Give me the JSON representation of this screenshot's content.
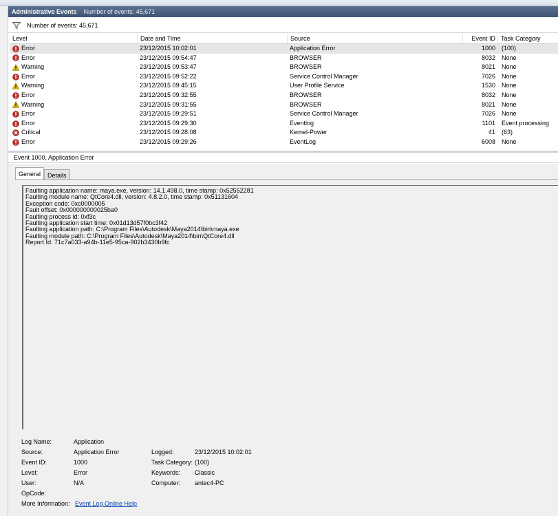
{
  "window": {
    "title": "Administrative Events",
    "count_text": "Number of events: 45,671"
  },
  "filter": {
    "text": "Number of events: 45,671"
  },
  "columns": [
    "Level",
    "Date and Time",
    "Source",
    "Event ID",
    "Task Category"
  ],
  "rows": [
    {
      "level": "Error",
      "type": "error",
      "date": "23/12/2015 10:02:01",
      "source": "Application Error",
      "id": "1000",
      "category": "(100)",
      "selected": true
    },
    {
      "level": "Error",
      "type": "error",
      "date": "23/12/2015 09:54:47",
      "source": "BROWSER",
      "id": "8032",
      "category": "None"
    },
    {
      "level": "Warning",
      "type": "warning",
      "date": "23/12/2015 09:53:47",
      "source": "BROWSER",
      "id": "8021",
      "category": "None"
    },
    {
      "level": "Error",
      "type": "error",
      "date": "23/12/2015 09:52:22",
      "source": "Service Control Manager",
      "id": "7026",
      "category": "None"
    },
    {
      "level": "Warning",
      "type": "warning",
      "date": "23/12/2015 09:45:15",
      "source": "User Profile Service",
      "id": "1530",
      "category": "None"
    },
    {
      "level": "Error",
      "type": "error",
      "date": "23/12/2015 09:32:55",
      "source": "BROWSER",
      "id": "8032",
      "category": "None"
    },
    {
      "level": "Warning",
      "type": "warning",
      "date": "23/12/2015 09:31:55",
      "source": "BROWSER",
      "id": "8021",
      "category": "None"
    },
    {
      "level": "Error",
      "type": "error",
      "date": "23/12/2015 09:29:51",
      "source": "Service Control Manager",
      "id": "7026",
      "category": "None"
    },
    {
      "level": "Error",
      "type": "error",
      "date": "23/12/2015 09:29:30",
      "source": "Eventlog",
      "id": "1101",
      "category": "Event processing"
    },
    {
      "level": "Critical",
      "type": "critical",
      "date": "23/12/2015 09:28:08",
      "source": "Kernel-Power",
      "id": "41",
      "category": "(63)"
    },
    {
      "level": "Error",
      "type": "error",
      "date": "23/12/2015 09:29:26",
      "source": "EventLog",
      "id": "6008",
      "category": "None"
    }
  ],
  "detail": {
    "header": "Event 1000, Application Error",
    "tabs": [
      "General",
      "Details"
    ],
    "description": [
      "Faulting application name: maya.exe, version: 14.1.498.0, time stamp: 0x52552281",
      "Faulting module name: QtCore4.dll, version: 4.8.2.0, time stamp: 0x51131604",
      "Exception code: 0xc0000005",
      "Fault offset: 0x000000000025ba0",
      "Faulting process id: 0xf3c",
      "Faulting application start time: 0x01d13d57f0bc3f42",
      "Faulting application path: C:\\Program Files\\Autodesk\\Maya2014\\bin\\maya.exe",
      "Faulting module path: C:\\Program Files\\Autodesk\\Maya2014\\bin\\QtCore4.dll",
      "Report Id: 71c7a033-a94b-11e5-95ca-902b3430b9fc"
    ],
    "props": {
      "log_name_label": "Log Name:",
      "log_name": "Application",
      "source_label": "Source:",
      "source": "Application Error",
      "logged_label": "Logged:",
      "logged": "23/12/2015 10:02:01",
      "event_id_label": "Event ID:",
      "event_id": "1000",
      "task_category_label": "Task Category:",
      "task_category": "(100)",
      "level_label": "Level:",
      "level": "Error",
      "keywords_label": "Keywords:",
      "keywords": "Classic",
      "user_label": "User:",
      "user": "N/A",
      "computer_label": "Computer:",
      "computer": "antec4-PC",
      "opcode_label": "OpCode:",
      "more_info_label": "More Information:",
      "more_info_link": "Event Log Online Help"
    }
  },
  "colors": {
    "error": "#c0302c",
    "warning": "#f2c200",
    "critical": "#c0302c",
    "titlebar": "#4a5f7e"
  }
}
